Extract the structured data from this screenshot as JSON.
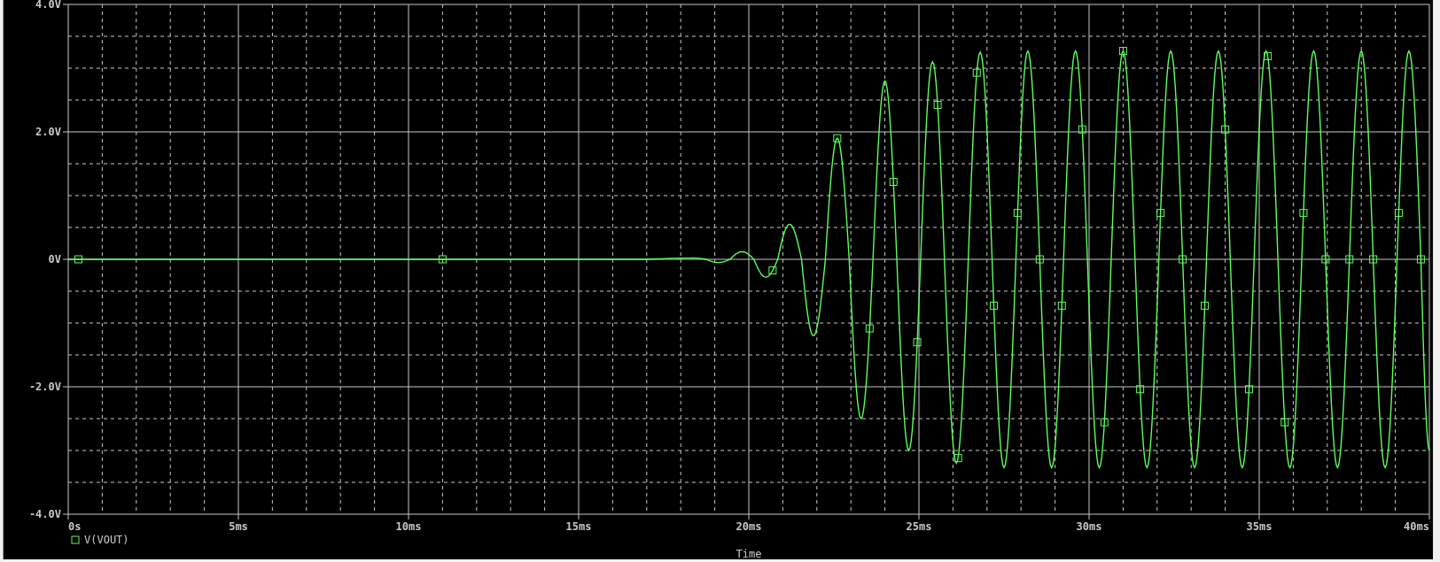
{
  "chart_data": {
    "type": "line",
    "grid": true,
    "xlabel": "Time",
    "xlim": [
      0,
      40
    ],
    "ylim": [
      -4,
      4
    ],
    "xticks": [
      {
        "value": 0,
        "label": "0s"
      },
      {
        "value": 5,
        "label": "5ms"
      },
      {
        "value": 10,
        "label": "10ms"
      },
      {
        "value": 15,
        "label": "15ms"
      },
      {
        "value": 20,
        "label": "20ms"
      },
      {
        "value": 25,
        "label": "25ms"
      },
      {
        "value": 30,
        "label": "30ms"
      },
      {
        "value": 35,
        "label": "35ms"
      },
      {
        "value": 40,
        "label": "40ms"
      }
    ],
    "yticks": [
      {
        "value": 4,
        "label": "4.0V"
      },
      {
        "value": 2,
        "label": "2.0V"
      },
      {
        "value": 0,
        "label": "0V"
      },
      {
        "value": -2,
        "label": "-2.0V"
      },
      {
        "value": -4,
        "label": "-4.0V"
      }
    ],
    "x": [
      0,
      17,
      18.4,
      18.75,
      19.1,
      19.45,
      19.8,
      20.15,
      20.5,
      20.85,
      21.2,
      21.55,
      21.9,
      22.25,
      22.6,
      22.95,
      23.3,
      23.65,
      24.0,
      24.35,
      24.7,
      25.05,
      25.4,
      25.75,
      26.1,
      26.45,
      26.8,
      27.15,
      27.5,
      27.85,
      28.2,
      28.55,
      28.9,
      29.25,
      29.6,
      29.95,
      30.3,
      30.65,
      31.0,
      31.35,
      31.7,
      32.05,
      32.4,
      32.75,
      33.1,
      33.45,
      33.8,
      34.15,
      34.5,
      34.85,
      35.2,
      35.55,
      35.9,
      36.25,
      36.6,
      36.95,
      37.3,
      37.65,
      38.0,
      38.35,
      38.7,
      39.05,
      39.4,
      39.75,
      40
    ],
    "series": [
      {
        "name": "V(VOUT)",
        "color": "#5cff5c",
        "values": [
          0,
          0,
          0.02,
          0,
          -0.05,
          0,
          0.12,
          0,
          -0.28,
          0,
          0.55,
          0,
          -1.2,
          0,
          1.9,
          0,
          -2.5,
          0,
          2.8,
          0,
          -3.0,
          0,
          3.1,
          0,
          -3.2,
          0,
          3.25,
          0,
          -3.27,
          0,
          3.27,
          0,
          -3.27,
          0,
          3.27,
          0,
          -3.27,
          0,
          3.27,
          0,
          -3.27,
          0,
          3.27,
          0,
          -3.27,
          0,
          3.27,
          0,
          -3.27,
          0,
          3.27,
          0,
          -3.27,
          0,
          3.27,
          0,
          -3.27,
          0,
          3.27,
          0,
          -3.27,
          0,
          3.27,
          0,
          -3.0
        ]
      }
    ]
  }
}
